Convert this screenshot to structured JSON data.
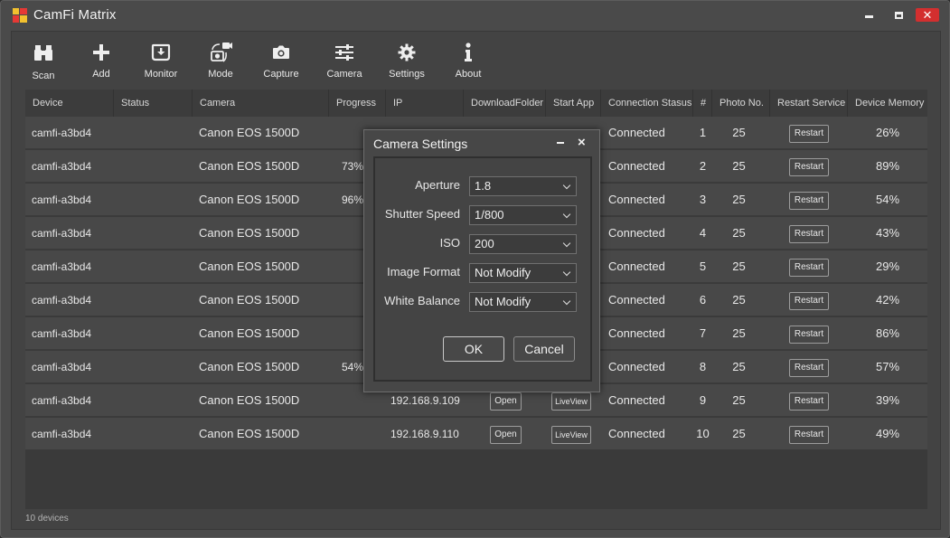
{
  "window": {
    "title": "CamFi Matrix",
    "close_glyph": "✕"
  },
  "toolbar": {
    "items": [
      {
        "label": "Scan",
        "icon": "binoculars-icon"
      },
      {
        "label": "Add",
        "icon": "plus-icon"
      },
      {
        "label": "Monitor",
        "icon": "download-box-icon"
      },
      {
        "label": "Mode",
        "icon": "camera-mode-icon"
      },
      {
        "label": "Capture",
        "icon": "camera-icon"
      },
      {
        "label": "Camera",
        "icon": "sliders-icon"
      },
      {
        "label": "Settings",
        "icon": "gear-icon"
      },
      {
        "label": "About",
        "icon": "info-icon"
      }
    ]
  },
  "table": {
    "columns": [
      "Device",
      "Status",
      "Camera",
      "Progress",
      "IP",
      "DownloadFolder",
      "Start App",
      "Connection Stasus",
      "#",
      "Photo No.",
      "Restart Service",
      "Device Memory"
    ],
    "open_label": "Open",
    "liveview_label": "LiveView",
    "restart_label": "Restart",
    "rows": [
      {
        "device": "camfi-a3bd4",
        "status": "",
        "camera": "Canon EOS 1500D",
        "progress": "",
        "ip": "",
        "connection": "Connected",
        "index": "1",
        "photo_no": "25",
        "memory": "26%"
      },
      {
        "device": "camfi-a3bd4",
        "status": "",
        "camera": "Canon EOS 1500D",
        "progress": "73%",
        "ip": "",
        "connection": "Connected",
        "index": "2",
        "photo_no": "25",
        "memory": "89%"
      },
      {
        "device": "camfi-a3bd4",
        "status": "",
        "camera": "Canon EOS 1500D",
        "progress": "96%",
        "ip": "",
        "connection": "Connected",
        "index": "3",
        "photo_no": "25",
        "memory": "54%"
      },
      {
        "device": "camfi-a3bd4",
        "status": "",
        "camera": "Canon EOS 1500D",
        "progress": "",
        "ip": "",
        "connection": "Connected",
        "index": "4",
        "photo_no": "25",
        "memory": "43%"
      },
      {
        "device": "camfi-a3bd4",
        "status": "",
        "camera": "Canon EOS 1500D",
        "progress": "",
        "ip": "",
        "connection": "Connected",
        "index": "5",
        "photo_no": "25",
        "memory": "29%"
      },
      {
        "device": "camfi-a3bd4",
        "status": "",
        "camera": "Canon EOS 1500D",
        "progress": "",
        "ip": "",
        "connection": "Connected",
        "index": "6",
        "photo_no": "25",
        "memory": "42%"
      },
      {
        "device": "camfi-a3bd4",
        "status": "",
        "camera": "Canon EOS 1500D",
        "progress": "",
        "ip": "",
        "connection": "Connected",
        "index": "7",
        "photo_no": "25",
        "memory": "86%"
      },
      {
        "device": "camfi-a3bd4",
        "status": "",
        "camera": "Canon EOS 1500D",
        "progress": "54%",
        "ip": "",
        "connection": "Connected",
        "index": "8",
        "photo_no": "25",
        "memory": "57%"
      },
      {
        "device": "camfi-a3bd4",
        "status": "",
        "camera": "Canon EOS 1500D",
        "progress": "",
        "ip": "192.168.9.109",
        "connection": "Connected",
        "index": "9",
        "photo_no": "25",
        "memory": "39%"
      },
      {
        "device": "camfi-a3bd4",
        "status": "",
        "camera": "Canon EOS 1500D",
        "progress": "",
        "ip": "192.168.9.110",
        "connection": "Connected",
        "index": "10",
        "photo_no": "25",
        "memory": "49%"
      }
    ]
  },
  "status_bar": {
    "text": "10 devices"
  },
  "dialog": {
    "title": "Camera Settings",
    "close_glyph": "×",
    "fields": [
      {
        "label": "Aperture",
        "value": "1.8"
      },
      {
        "label": "Shutter Speed",
        "value": "1/800"
      },
      {
        "label": "ISO",
        "value": "200"
      },
      {
        "label": "Image Format",
        "value": "Not Modify"
      },
      {
        "label": "White Balance",
        "value": "Not Modify"
      }
    ],
    "ok_label": "OK",
    "cancel_label": "Cancel"
  },
  "colors": {
    "close_button": "#d32f2f",
    "background": "#4a4a4a",
    "row": "#484848"
  }
}
